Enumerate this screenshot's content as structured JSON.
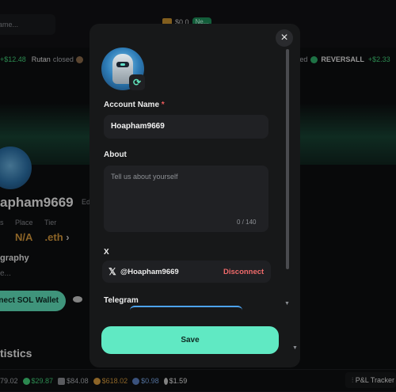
{
  "background": {
    "search_placeholder": "ame...",
    "wallet_balance": "$0.0",
    "wallet_badge": "Ne...",
    "ticker": [
      {
        "text": "+$12.48",
        "kind": "green"
      },
      {
        "text": "Rutan",
        "kind": "white"
      },
      {
        "text": "closed",
        "kind": "gray"
      },
      {
        "text": "osed",
        "kind": "gray"
      },
      {
        "text": "REVERSALL",
        "kind": "white"
      },
      {
        "text": "+$2.33",
        "kind": "green"
      }
    ],
    "profile_name": "apham9669",
    "edit_label": "Ed",
    "stat_labels": [
      "s",
      "Place",
      "Tier"
    ],
    "place_value": "N/A",
    "tier_value": ".eth",
    "bio_heading": "graphy",
    "bio_text": "e...",
    "connect_wallet": "nect SOL Wallet",
    "statistics": "tistics",
    "bottom_prices": [
      {
        "text": "79.02",
        "color": "#a9acb1"
      },
      {
        "text": "$29.87",
        "color": "#43d17a"
      },
      {
        "text": "$84.08",
        "color": "#a9acb1"
      },
      {
        "text": "$618.02",
        "color": "#d79a3c"
      },
      {
        "text": "$0.98",
        "color": "#7aa8e8"
      },
      {
        "text": "$1.59",
        "color": "#e6e6e6"
      }
    ],
    "pnl_tracker": "P&L Tracker"
  },
  "modal": {
    "close_symbol": "×",
    "account_name_label": "Account Name",
    "required_mark": "*",
    "account_name_value": "Hoapham9669",
    "about_label": "About",
    "about_placeholder": "Tell us about yourself",
    "about_counter": "0 / 140",
    "x_label": "X",
    "x_handle": "@Hoapham9669",
    "x_disconnect": "Disconnect",
    "telegram_label": "Telegram",
    "save_label": "Save",
    "refresh_icon": "refresh-icon"
  },
  "colors": {
    "accent": "#60e9c3",
    "danger": "#ef6a6a",
    "panel": "#171819"
  }
}
